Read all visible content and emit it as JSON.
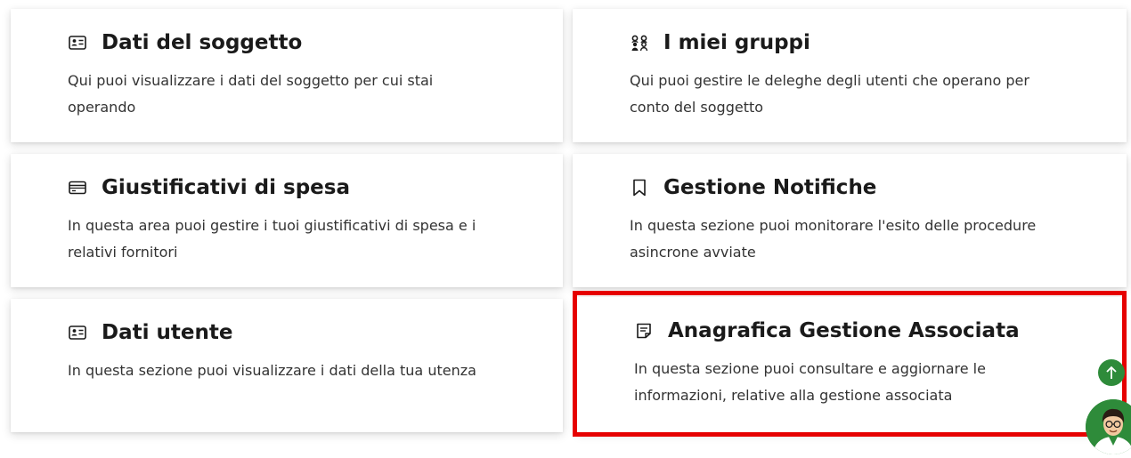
{
  "cards": [
    {
      "title": "Dati del soggetto",
      "description": "Qui puoi visualizzare i dati del soggetto per cui stai operando",
      "icon": "id-card-icon"
    },
    {
      "title": "I miei gruppi",
      "description": "Qui puoi gestire le deleghe degli utenti che operano per conto del soggetto",
      "icon": "group-icon"
    },
    {
      "title": "Giustificativi di spesa",
      "description": "In questa area puoi gestire i tuoi giustificativi di spesa e i relativi fornitori",
      "icon": "credit-card-icon"
    },
    {
      "title": "Gestione Notifiche",
      "description": "In questa sezione puoi monitorare l'esito delle procedure asincrone avviate",
      "icon": "bookmark-icon"
    },
    {
      "title": "Dati utente",
      "description": "In questa sezione puoi visualizzare i dati della tua utenza",
      "icon": "id-card-icon"
    },
    {
      "title": "Anagrafica Gestione Associata",
      "description": "In questa sezione puoi consultare e aggiornare le informazioni, relative alla gestione associata",
      "icon": "note-icon"
    }
  ],
  "colors": {
    "highlight": "#e60000",
    "accent_green": "#2e8b3a"
  },
  "floating": {
    "scroll_top_icon": "arrow-up-icon",
    "assistant_icon": "assistant-avatar-icon"
  }
}
